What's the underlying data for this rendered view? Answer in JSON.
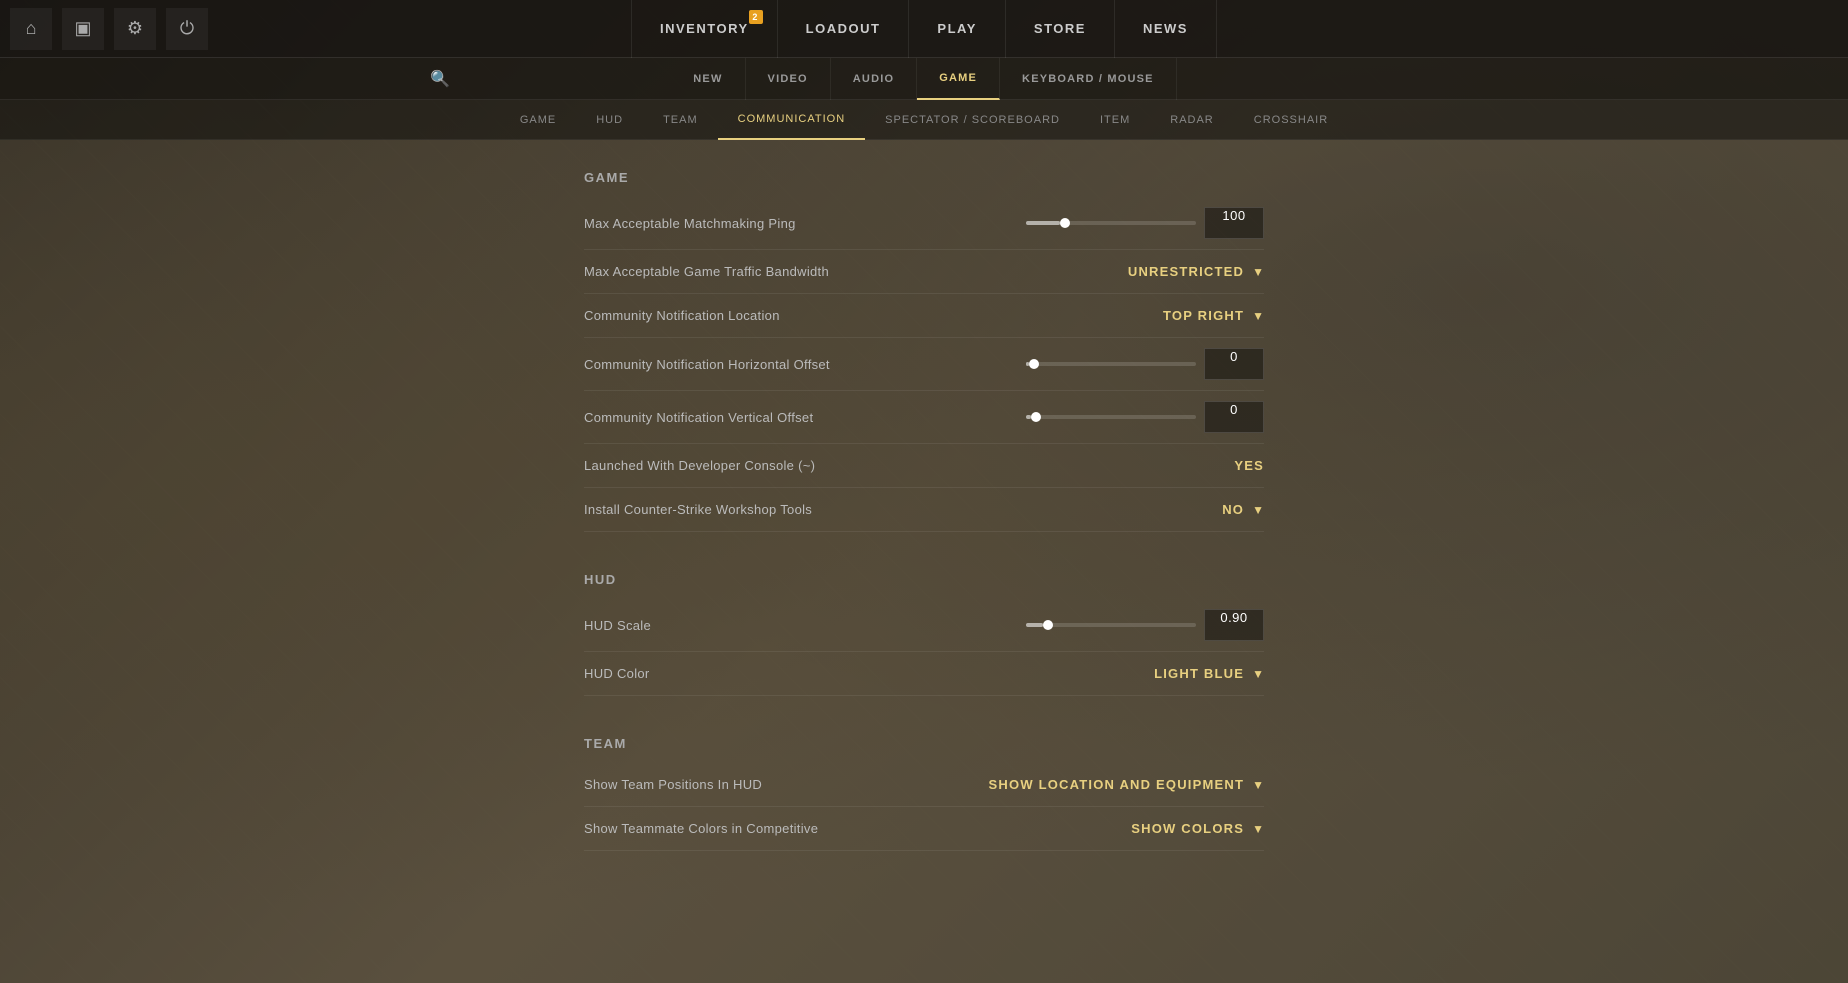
{
  "topNav": {
    "icons": [
      {
        "name": "home-icon",
        "symbol": "⌂"
      },
      {
        "name": "tv-icon",
        "symbol": "▣"
      },
      {
        "name": "gear-icon",
        "symbol": "⚙"
      },
      {
        "name": "power-icon",
        "symbol": "⏻"
      }
    ],
    "items": [
      {
        "label": "INVENTORY",
        "active": false,
        "badge": "2",
        "id": "inventory"
      },
      {
        "label": "LOADOUT",
        "active": false,
        "id": "loadout"
      },
      {
        "label": "PLAY",
        "active": false,
        "id": "play"
      },
      {
        "label": "STORE",
        "active": false,
        "id": "store"
      },
      {
        "label": "NEWS",
        "active": false,
        "id": "news"
      }
    ]
  },
  "settingsNav": {
    "items": [
      {
        "label": "NEW",
        "active": false,
        "id": "new"
      },
      {
        "label": "VIDEO",
        "active": false,
        "id": "video"
      },
      {
        "label": "AUDIO",
        "active": false,
        "id": "audio"
      },
      {
        "label": "GAME",
        "active": true,
        "id": "game"
      },
      {
        "label": "KEYBOARD / MOUSE",
        "active": false,
        "id": "keyboard-mouse"
      }
    ]
  },
  "categoryNav": {
    "items": [
      {
        "label": "GAME",
        "active": false,
        "id": "game"
      },
      {
        "label": "HUD",
        "active": false,
        "id": "hud"
      },
      {
        "label": "TEAM",
        "active": false,
        "id": "team"
      },
      {
        "label": "COMMUNICATION",
        "active": true,
        "id": "communication"
      },
      {
        "label": "SPECTATOR / SCOREBOARD",
        "active": false,
        "id": "spectator"
      },
      {
        "label": "ITEM",
        "active": false,
        "id": "item"
      },
      {
        "label": "RADAR",
        "active": false,
        "id": "radar"
      },
      {
        "label": "CROSSHAIR",
        "active": false,
        "id": "crosshair"
      }
    ]
  },
  "sections": {
    "game": {
      "header": "Game",
      "settings": [
        {
          "id": "max-ping",
          "label": "Max Acceptable Matchmaking Ping",
          "type": "slider-input",
          "sliderFill": 20,
          "value": "100"
        },
        {
          "id": "bandwidth",
          "label": "Max Acceptable Game Traffic Bandwidth",
          "type": "dropdown",
          "value": "UNRESTRICTED"
        },
        {
          "id": "notification-location",
          "label": "Community Notification Location",
          "type": "dropdown",
          "value": "TOP RIGHT"
        },
        {
          "id": "notification-h-offset",
          "label": "Community Notification Horizontal Offset",
          "type": "slider-input",
          "sliderFill": 2,
          "value": "0"
        },
        {
          "id": "notification-v-offset",
          "label": "Community Notification Vertical Offset",
          "type": "slider-input",
          "sliderFill": 3,
          "value": "0"
        },
        {
          "id": "dev-console",
          "label": "Launched With Developer Console (~)",
          "type": "value",
          "value": "YES"
        },
        {
          "id": "workshop-tools",
          "label": "Install Counter-Strike Workshop Tools",
          "type": "dropdown",
          "value": "NO"
        }
      ]
    },
    "hud": {
      "header": "Hud",
      "settings": [
        {
          "id": "hud-scale",
          "label": "HUD Scale",
          "type": "slider-input",
          "sliderFill": 10,
          "value": "0.90"
        },
        {
          "id": "hud-color",
          "label": "HUD Color",
          "type": "dropdown",
          "value": "LIGHT BLUE"
        }
      ]
    },
    "team": {
      "header": "Team",
      "settings": [
        {
          "id": "show-team-positions",
          "label": "Show Team Positions In HUD",
          "type": "dropdown",
          "value": "SHOW LOCATION AND EQUIPMENT"
        },
        {
          "id": "teammate-colors",
          "label": "Show Teammate Colors in Competitive",
          "type": "dropdown",
          "value": "SHOW COLORS"
        }
      ]
    }
  }
}
